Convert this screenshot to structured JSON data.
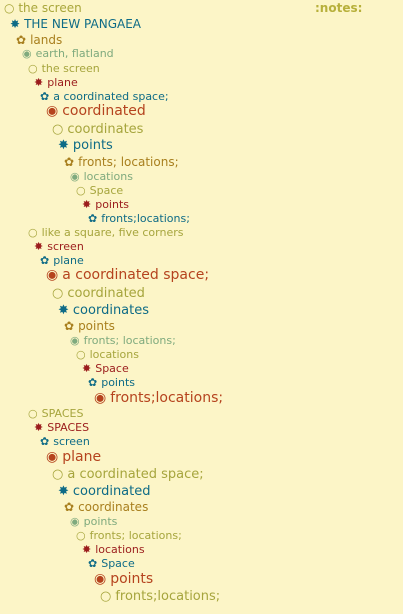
{
  "header": {
    "title": "the screen",
    "notes": ":notes:"
  },
  "bullets": {
    "circle": "○",
    "star": "✸",
    "flower": "✿",
    "dot": "◉"
  },
  "colors": {
    "background": "#fcf5c7",
    "teal": "#0e6b86",
    "olive": "#a6a53d",
    "gold": "#a87f1e",
    "sage": "#7faa7e",
    "maroon": "#9b1c1c",
    "rust": "#b5431e"
  },
  "outline": [
    {
      "text": "THE NEW PANGAEA",
      "bullet": "star",
      "color": "teal",
      "size": 12
    },
    {
      "text": "lands",
      "bullet": "flower",
      "color": "gold",
      "size": 12
    },
    {
      "text": "earth, flatland",
      "bullet": "dot",
      "color": "sage",
      "size": 11
    },
    {
      "text": "the screen",
      "bullet": "circle",
      "color": "olive",
      "size": 11
    },
    {
      "text": "plane",
      "bullet": "star",
      "color": "maroon",
      "size": 11
    },
    {
      "text": "a coordinated space;",
      "bullet": "flower",
      "color": "teal",
      "size": 11
    },
    {
      "text": "coordinated",
      "bullet": "dot",
      "color": "rust",
      "size": 14
    },
    {
      "text": "coordinates",
      "bullet": "circle",
      "color": "olive",
      "size": 13
    },
    {
      "text": "points",
      "bullet": "star",
      "color": "teal",
      "size": 13
    },
    {
      "text": "fronts; locations;",
      "bullet": "flower",
      "color": "gold",
      "size": 12
    },
    {
      "text": "locations",
      "bullet": "dot",
      "color": "sage",
      "size": 11
    },
    {
      "text": "Space",
      "bullet": "circle",
      "color": "olive",
      "size": 11
    },
    {
      "text": "points",
      "bullet": "star",
      "color": "maroon",
      "size": 11
    },
    {
      "text": "fronts;locations;",
      "bullet": "flower",
      "color": "teal",
      "size": 11
    },
    {
      "text": "like a square, five corners",
      "bullet": "circle",
      "color": "olive",
      "size": 11
    },
    {
      "text": "screen",
      "bullet": "star",
      "color": "maroon",
      "size": 11
    },
    {
      "text": "plane",
      "bullet": "flower",
      "color": "teal",
      "size": 11
    },
    {
      "text": "a coordinated space;",
      "bullet": "dot",
      "color": "rust",
      "size": 14
    },
    {
      "text": "coordinated",
      "bullet": "circle",
      "color": "olive",
      "size": 13
    },
    {
      "text": "coordinates",
      "bullet": "star",
      "color": "teal",
      "size": 13
    },
    {
      "text": "points",
      "bullet": "flower",
      "color": "gold",
      "size": 12
    },
    {
      "text": "fronts; locations;",
      "bullet": "dot",
      "color": "sage",
      "size": 11
    },
    {
      "text": "locations",
      "bullet": "circle",
      "color": "olive",
      "size": 11
    },
    {
      "text": "Space",
      "bullet": "star",
      "color": "maroon",
      "size": 11
    },
    {
      "text": "points",
      "bullet": "flower",
      "color": "teal",
      "size": 11
    },
    {
      "text": "fronts;locations;",
      "bullet": "dot",
      "color": "rust",
      "size": 14
    },
    {
      "text": "SPACES",
      "bullet": "circle",
      "color": "olive",
      "size": 11
    },
    {
      "text": "SPACES",
      "bullet": "star",
      "color": "maroon",
      "size": 11
    },
    {
      "text": "screen",
      "bullet": "flower",
      "color": "teal",
      "size": 11
    },
    {
      "text": "plane",
      "bullet": "dot",
      "color": "rust",
      "size": 14
    },
    {
      "text": "a coordinated space;",
      "bullet": "circle",
      "color": "olive",
      "size": 13
    },
    {
      "text": "coordinated",
      "bullet": "star",
      "color": "teal",
      "size": 13
    },
    {
      "text": "coordinates",
      "bullet": "flower",
      "color": "gold",
      "size": 12
    },
    {
      "text": "points",
      "bullet": "dot",
      "color": "sage",
      "size": 11
    },
    {
      "text": "fronts; locations;",
      "bullet": "circle",
      "color": "olive",
      "size": 11
    },
    {
      "text": "locations",
      "bullet": "star",
      "color": "maroon",
      "size": 11
    },
    {
      "text": "Space",
      "bullet": "flower",
      "color": "teal",
      "size": 11
    },
    {
      "text": "points",
      "bullet": "dot",
      "color": "rust",
      "size": 14
    },
    {
      "text": "fronts;locations;",
      "bullet": "circle",
      "color": "olive",
      "size": 13
    }
  ]
}
